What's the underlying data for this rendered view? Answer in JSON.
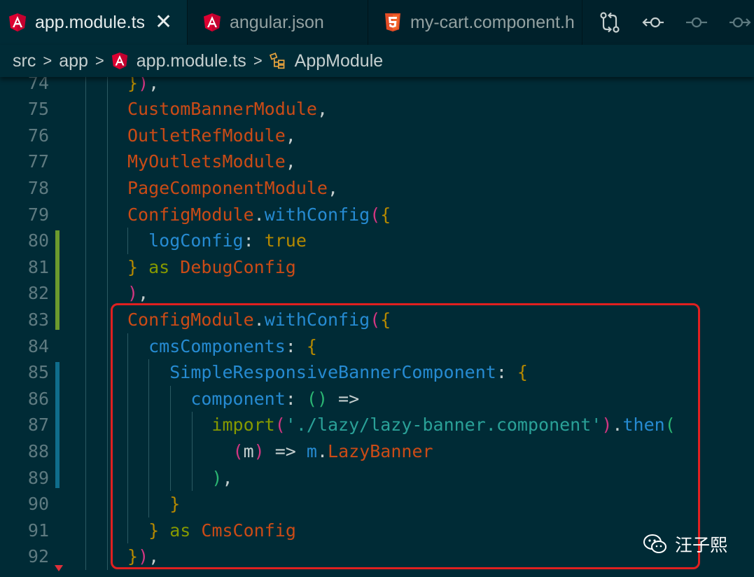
{
  "tabs": [
    {
      "label": "app.module.ts",
      "icon": "angular-icon",
      "active": true,
      "close": "✕"
    },
    {
      "label": "angular.json",
      "icon": "angular-icon",
      "active": false
    },
    {
      "label": "my-cart.component.h",
      "icon": "html5-icon",
      "active": false
    }
  ],
  "toolbar_actions": [
    "compare-changes-icon",
    "go-back-icon",
    "commit-icon",
    "go-forward-icon"
  ],
  "breadcrumb": {
    "items": [
      "src",
      "app",
      "app.module.ts",
      "AppModule"
    ],
    "separator": ">"
  },
  "editor": {
    "lines": [
      {
        "n": "74",
        "tokens": [
          [
            "t-bracket",
            "}"
          ],
          [
            "t-paren",
            ")"
          ],
          [
            "t-punct",
            ","
          ]
        ]
      },
      {
        "n": "75",
        "tokens": [
          [
            "t-class",
            "CustomBannerModule"
          ],
          [
            "t-punct",
            ","
          ]
        ]
      },
      {
        "n": "76",
        "tokens": [
          [
            "t-class",
            "OutletRefModule"
          ],
          [
            "t-punct",
            ","
          ]
        ]
      },
      {
        "n": "77",
        "tokens": [
          [
            "t-class",
            "MyOutletsModule"
          ],
          [
            "t-punct",
            ","
          ]
        ]
      },
      {
        "n": "78",
        "tokens": [
          [
            "t-class",
            "PageComponentModule"
          ],
          [
            "t-punct",
            ","
          ]
        ]
      },
      {
        "n": "79",
        "tokens": [
          [
            "t-class",
            "ConfigModule"
          ],
          [
            "t-punct",
            "."
          ],
          [
            "t-fn",
            "withConfig"
          ],
          [
            "t-paren",
            "("
          ],
          [
            "t-bracket",
            "{"
          ]
        ]
      },
      {
        "n": "80",
        "tokens": [
          [
            "t-punct",
            "  "
          ],
          [
            "t-prop",
            "logConfig"
          ],
          [
            "t-punct",
            ": "
          ],
          [
            "t-bool",
            "true"
          ]
        ]
      },
      {
        "n": "81",
        "tokens": [
          [
            "t-bracket",
            "}"
          ],
          [
            "t-punct",
            " "
          ],
          [
            "t-kw",
            "as"
          ],
          [
            "t-punct",
            " "
          ],
          [
            "t-class",
            "DebugConfig"
          ]
        ]
      },
      {
        "n": "82",
        "tokens": [
          [
            "t-paren",
            ")"
          ],
          [
            "t-punct",
            ","
          ]
        ]
      },
      {
        "n": "83",
        "tokens": [
          [
            "t-class",
            "ConfigModule"
          ],
          [
            "t-punct",
            "."
          ],
          [
            "t-fn",
            "withConfig"
          ],
          [
            "t-paren",
            "("
          ],
          [
            "t-bracket",
            "{"
          ]
        ]
      },
      {
        "n": "84",
        "tokens": [
          [
            "t-punct",
            "  "
          ],
          [
            "t-prop",
            "cmsComponents"
          ],
          [
            "t-punct",
            ": "
          ],
          [
            "t-bracket",
            "{"
          ]
        ]
      },
      {
        "n": "85",
        "tokens": [
          [
            "t-punct",
            "    "
          ],
          [
            "t-prop",
            "SimpleResponsiveBannerComponent"
          ],
          [
            "t-punct",
            ": "
          ],
          [
            "t-bracket",
            "{"
          ]
        ]
      },
      {
        "n": "86",
        "tokens": [
          [
            "t-punct",
            "      "
          ],
          [
            "t-prop",
            "component"
          ],
          [
            "t-punct",
            ": "
          ],
          [
            "t-green",
            "()"
          ],
          [
            "t-punct",
            " =>"
          ]
        ]
      },
      {
        "n": "87",
        "tokens": [
          [
            "t-punct",
            "        "
          ],
          [
            "t-kw",
            "import"
          ],
          [
            "t-paren",
            "("
          ],
          [
            "t-str",
            "'./lazy/lazy-banner.component'"
          ],
          [
            "t-paren",
            ")"
          ],
          [
            "t-punct",
            "."
          ],
          [
            "t-fn",
            "then"
          ],
          [
            "t-green",
            "("
          ]
        ]
      },
      {
        "n": "88",
        "tokens": [
          [
            "t-punct",
            "          "
          ],
          [
            "t-paren",
            "("
          ],
          [
            "t-param",
            "m"
          ],
          [
            "t-paren",
            ")"
          ],
          [
            "t-punct",
            " => "
          ],
          [
            "t-prop",
            "m"
          ],
          [
            "t-punct",
            "."
          ],
          [
            "t-class",
            "LazyBanner"
          ]
        ]
      },
      {
        "n": "89",
        "tokens": [
          [
            "t-punct",
            "        "
          ],
          [
            "t-green",
            ")"
          ],
          [
            "t-punct",
            ","
          ]
        ]
      },
      {
        "n": "90",
        "tokens": [
          [
            "t-punct",
            "    "
          ],
          [
            "t-bracket",
            "}"
          ]
        ]
      },
      {
        "n": "91",
        "tokens": [
          [
            "t-punct",
            "  "
          ],
          [
            "t-bracket",
            "}"
          ],
          [
            "t-punct",
            " "
          ],
          [
            "t-kw",
            "as"
          ],
          [
            "t-punct",
            " "
          ],
          [
            "t-class",
            "CmsConfig"
          ]
        ]
      },
      {
        "n": "92",
        "tokens": [
          [
            "t-bracket",
            "}"
          ],
          [
            "t-paren",
            ")"
          ],
          [
            "t-punct",
            ","
          ]
        ]
      }
    ]
  },
  "watermark": {
    "text": "汪子熙",
    "icon": "wechat-icon"
  },
  "colors": {
    "background": "#002b36",
    "tabbar": "#00212b",
    "highlight_border": "#e02020",
    "angular_red": "#dd0031",
    "html5_orange": "#e44d26"
  }
}
